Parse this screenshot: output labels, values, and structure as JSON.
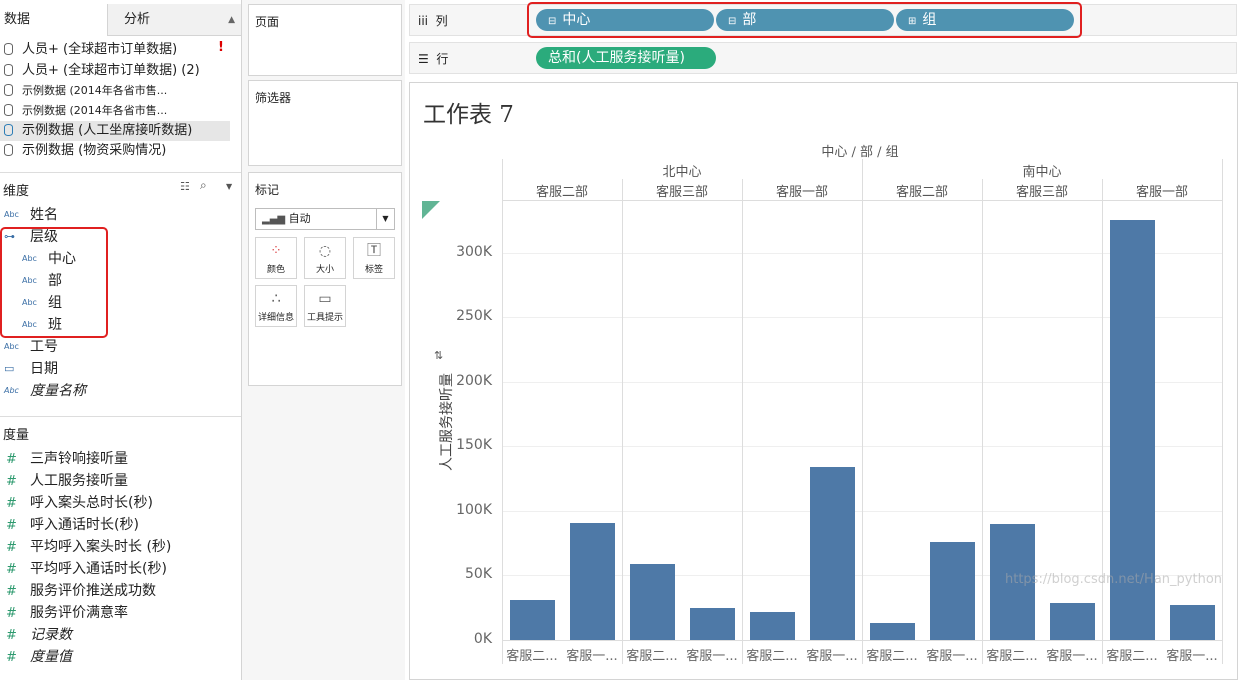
{
  "tabs": {
    "data": "数据",
    "analysis": "分析"
  },
  "datasources": [
    "人员+ (全球超市订单数据)",
    "人员+ (全球超市订单数据) (2)",
    "示例数据 (2014年各省市售...",
    "示例数据 (2014年各省市售...",
    "示例数据 (人工坐席接听数据)",
    "示例数据 (物资采购情况)"
  ],
  "warning": "!",
  "dimensions": {
    "title": "维度",
    "hierarchy": "层级",
    "fields": [
      "姓名",
      "中心",
      "部",
      "组",
      "班",
      "工号",
      "日期",
      "度量名称"
    ]
  },
  "measures": {
    "title": "度量",
    "fields": [
      "三声铃响接听量",
      "人工服务接听量",
      "呼入案头总时长(秒)",
      "呼入通话时长(秒)",
      "平均呼入案头时长 (秒)",
      "平均呼入通话时长(秒)",
      "服务评价推送成功数",
      "服务评价满意率",
      "记录数",
      "度量值"
    ]
  },
  "cards": {
    "pages": "页面",
    "filters": "筛选器",
    "marks": "标记",
    "mark_type": "自动",
    "mark_buttons": [
      "颜色",
      "大小",
      "标签",
      "详细信息",
      "工具提示"
    ]
  },
  "shelves": {
    "columns_label": "列",
    "rows_label": "行",
    "column_pills": [
      "中心",
      "部",
      "组"
    ],
    "row_pill": "总和(人工服务接听量)"
  },
  "colors": {
    "pill_blue": "#4f93b1",
    "pill_green": "#2bab7c",
    "bar": "#4e79a7",
    "highlight": "#e02020"
  },
  "chart_data": {
    "type": "bar",
    "title": "工作表 7",
    "header_title": "中心 / 部 / 组",
    "ylabel": "人工服务接听量",
    "ylim": [
      0,
      340000
    ],
    "yticks": [
      "300K",
      "250K",
      "200K",
      "150K",
      "100K",
      "50K",
      "0K"
    ],
    "centers": [
      "北中心",
      "南中心"
    ],
    "departments": [
      "客服二部",
      "客服三部",
      "客服一部",
      "客服二部",
      "客服三部",
      "客服一部"
    ],
    "categories": [
      "客服二...",
      "客服一...",
      "客服二...",
      "客服一...",
      "客服二...",
      "客服一...",
      "客服二...",
      "客服一...",
      "客服二...",
      "客服一...",
      "客服二...",
      "客服一..."
    ],
    "values": [
      31000,
      91000,
      59000,
      25000,
      22000,
      134000,
      13000,
      76000,
      90000,
      29000,
      325000,
      27000
    ]
  },
  "watermark": "https://blog.csdn.net/Han_python"
}
